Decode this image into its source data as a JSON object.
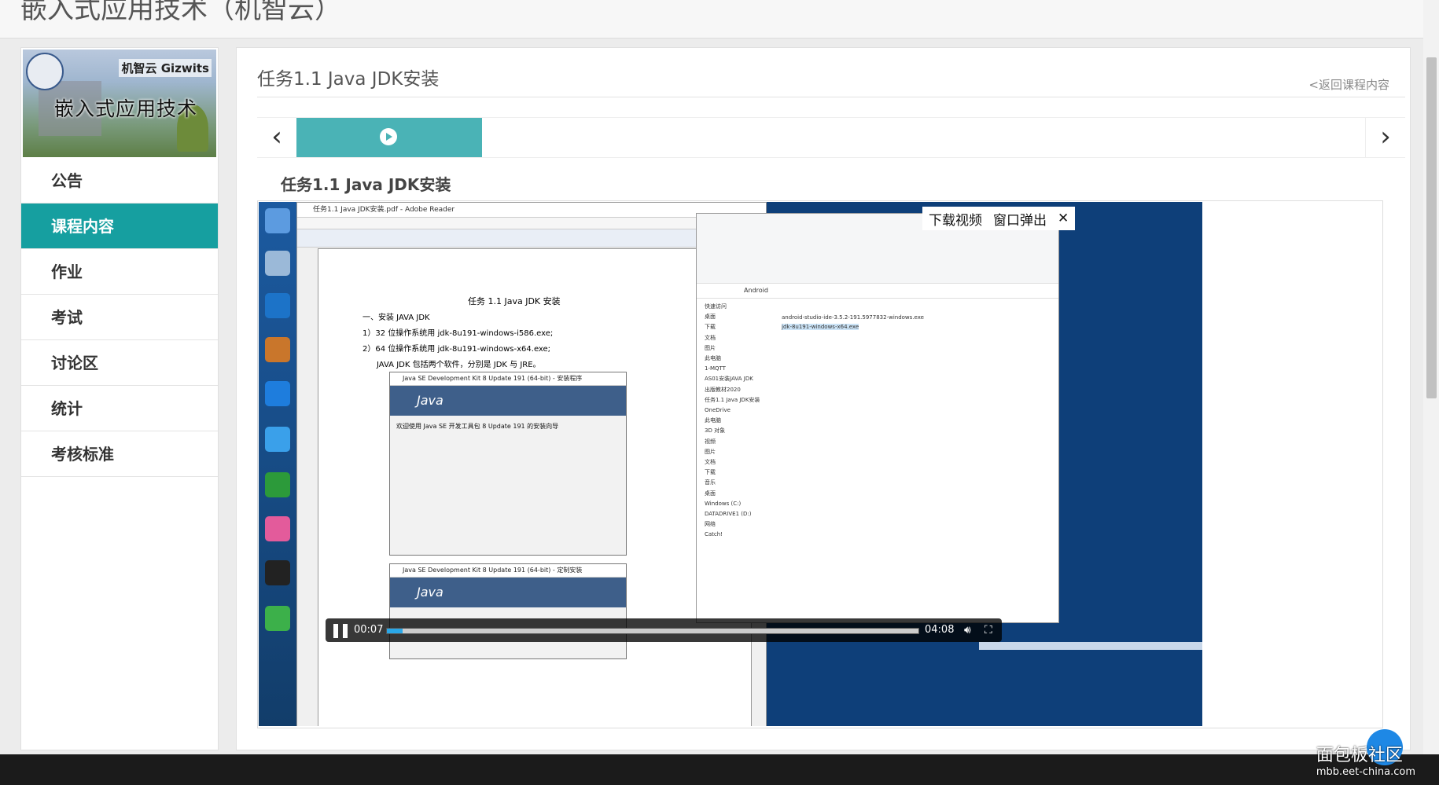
{
  "header": {
    "course_title": "嵌入式应用技术（机智云）"
  },
  "sidebar": {
    "banner_text": "嵌入式应用技术",
    "banner_logo": "机智云 Gizwits",
    "items": [
      {
        "label": "公告"
      },
      {
        "label": "课程内容",
        "active": true
      },
      {
        "label": "作业"
      },
      {
        "label": "考试"
      },
      {
        "label": "讨论区"
      },
      {
        "label": "统计"
      },
      {
        "label": "考核标准"
      }
    ]
  },
  "main": {
    "task_title": "任务1.1 Java JDK安装",
    "back_link": "<返回课程内容",
    "sub_title": "任务1.1 Java JDK安装",
    "nav": {
      "prev_icon": "chevron-left-icon",
      "next_icon": "chevron-right-icon"
    }
  },
  "video": {
    "download_label": "下载视频",
    "popout_label": "窗口弹出",
    "current_time": "00:07",
    "duration": "04:08",
    "progress": 0.03,
    "reader_title": "任务1.1 Java JDK安装.pdf - Adobe Reader",
    "pdf": {
      "heading": "任务 1.1  Java  JDK 安装",
      "lines": [
        "一、安装 JAVA JDK",
        "1）32 位操作系统用 jdk-8u191-windows-i586.exe;",
        "2）64 位操作系统用 jdk-8u191-windows-x64.exe;",
        "JAVA JDK 包括两个软件，分别是 JDK 与 JRE。"
      ],
      "dialog1_title": "Java SE Development Kit 8 Update 191 (64-bit) - 安装程序",
      "dialog1_text": "欢迎使用 Java SE 开发工具包 8 Update 191 的安装向导",
      "dialog2_title": "Java SE Development Kit 8 Update 191 (64-bit) - 定制安装"
    },
    "explorer": {
      "path": "Android",
      "files": [
        "android-studio-ide-3.5.2-191.5977832-windows.exe",
        "jdk-8u191-windows-x64.exe"
      ],
      "nav": [
        "快速访问",
        "桌面",
        "下载",
        "文档",
        "图片",
        "此电脑",
        "1-MQTT",
        "AS01安装JAVA JDK",
        "出版教材2020",
        "任务1.1 Java JDK安装",
        "OneDrive",
        "此电脑",
        "3D 对象",
        "视频",
        "图片",
        "文档",
        "下载",
        "音乐",
        "桌面",
        "Windows (C:)",
        "DATADRIVE1 (D:)",
        "网络",
        "Catch!"
      ]
    }
  },
  "watermark": {
    "line1": "面包板社区",
    "line2": "mbb.eet-china.com"
  },
  "colors": {
    "accent": "#169fa0",
    "play_tab": "#4ab3b6"
  }
}
